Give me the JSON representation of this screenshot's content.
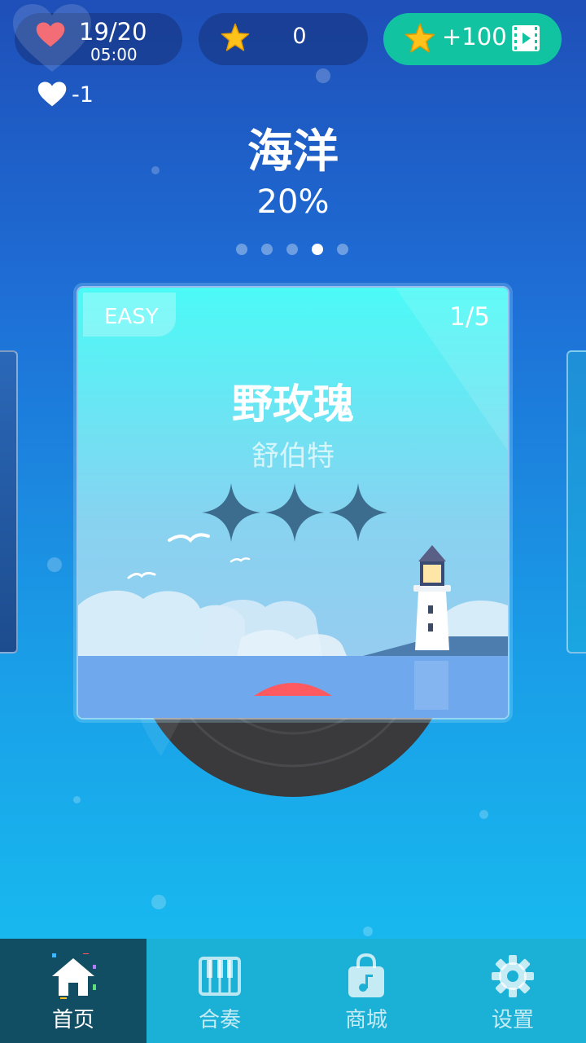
{
  "hud": {
    "lives": "19/20",
    "lives_timer": "05:00",
    "stars": "0",
    "reward_stars": "+100",
    "life_penalty": "-1"
  },
  "theme": {
    "title": "海洋",
    "progress": "20%",
    "page_count": 5,
    "active_page": 4
  },
  "song_card": {
    "difficulty": "EASY",
    "index": "1/5",
    "title": "野玫瑰",
    "artist": "舒伯特",
    "rating_stars_earned": 0,
    "rating_stars_total": 3
  },
  "nav": {
    "items": [
      {
        "label": "首页",
        "icon": "home-icon",
        "active": true
      },
      {
        "label": "合奏",
        "icon": "piano-icon",
        "active": false
      },
      {
        "label": "商城",
        "icon": "shop-bag-icon",
        "active": false
      },
      {
        "label": "设置",
        "icon": "gear-icon",
        "active": false
      }
    ]
  },
  "colors": {
    "reward_button": "#12c3a2",
    "hud_pill": "#1a3a84",
    "nav_bar": "#1bb0d6",
    "nav_active": "#114e63",
    "heart": "#f26d75",
    "star": "#ffc21a",
    "record_accent": "#ff5a5f"
  }
}
